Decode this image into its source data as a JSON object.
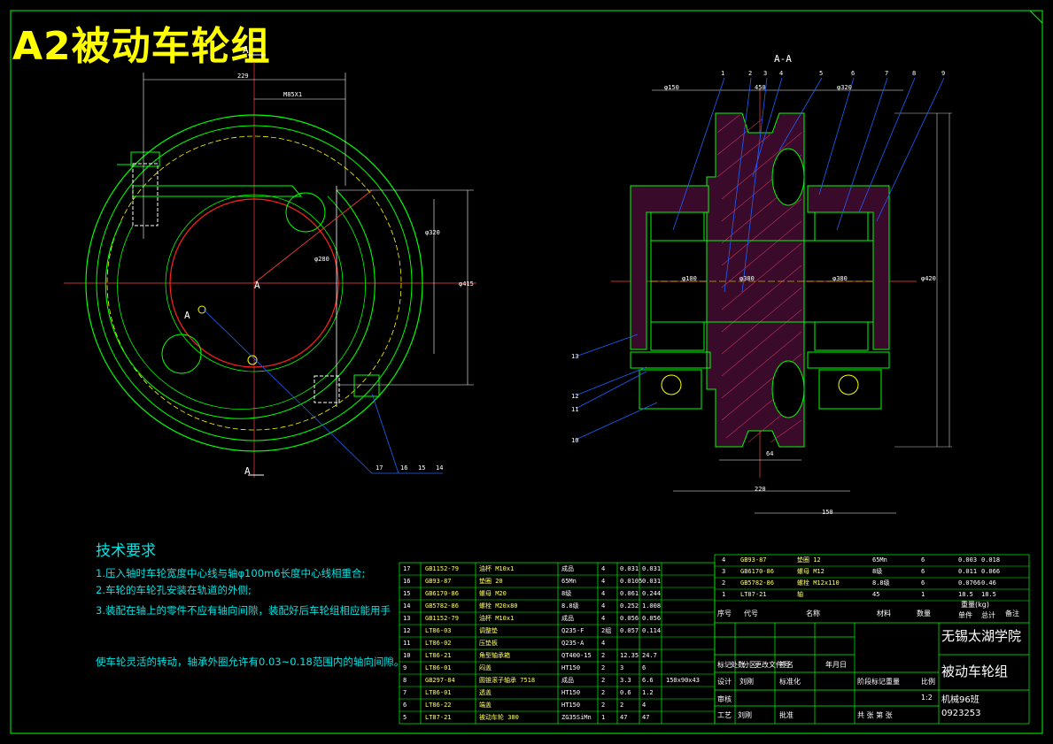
{
  "title": "A2被动车轮组",
  "section_label": "A-A",
  "view_marks": {
    "a_top": "A",
    "a_bottom": "A",
    "a_left": "A",
    "a_center": "A"
  },
  "dimensions_left": {
    "d1": "229",
    "d2": "M85X1",
    "d3": "φ280",
    "d4": "φ320",
    "d5": "φ415"
  },
  "dimensions_right": {
    "d1": "φ150",
    "d2": "450",
    "d3": "φ320",
    "d4": "φ100",
    "d5": "φ380",
    "d6": "φ380",
    "d7": "φ420",
    "d8": "64",
    "d9": "220",
    "d10": "150"
  },
  "balloons_top": [
    "1",
    "2",
    "3",
    "4",
    "5",
    "6",
    "7",
    "8",
    "9"
  ],
  "balloons_left": [
    "13",
    "12",
    "11",
    "10"
  ],
  "balloons_bottom": [
    "17",
    "16",
    "15",
    "14"
  ],
  "tech_requirements": {
    "heading": "技术要求",
    "items": [
      "1.压入轴时车轮宽度中心线与轴φ100m6长度中心线相重合;",
      "2.车轮的车轮孔安装在轨道的外侧;",
      "3.装配在轴上的零件不应有轴向间隙，装配好后车轮组相应能用手",
      "使车轮灵活的转动，轴承外圈允许有0.03~0.18范围内的轴向间隙。"
    ]
  },
  "parts_list_left": [
    {
      "no": "17",
      "code": "GB1152-79",
      "name": "油杯 M10x1",
      "material": "成品",
      "qty": "4",
      "unit": "0.031",
      "total": "0.031"
    },
    {
      "no": "16",
      "code": "GB93-87",
      "name": "垫圈 20",
      "material": "65Mn",
      "qty": "4",
      "unit": "0.0105",
      "total": "0.031"
    },
    {
      "no": "15",
      "code": "GB6170-86",
      "name": "螺母 M20",
      "material": "8级",
      "qty": "4",
      "unit": "0.061",
      "total": "0.244"
    },
    {
      "no": "14",
      "code": "GB5782-86",
      "name": "螺栓 M20x80",
      "material": "8.8级",
      "qty": "4",
      "unit": "0.252",
      "total": "1.008"
    },
    {
      "no": "13",
      "code": "GB1152-79",
      "name": "油杯 M10x1",
      "material": "成品",
      "qty": "4",
      "unit": "0.056",
      "total": "0.056"
    },
    {
      "no": "12",
      "code": "LT86-03",
      "name": "调整垫",
      "material": "Q235-F",
      "qty": "2组",
      "unit": "0.057",
      "total": "0.114"
    },
    {
      "no": "11",
      "code": "LT86-02",
      "name": "压垫板",
      "material": "Q235-A",
      "qty": "4",
      "unit": "",
      "total": ""
    },
    {
      "no": "10",
      "code": "LT86-21",
      "name": "角型轴承箱",
      "material": "QT400-15",
      "qty": "2",
      "unit": "12.35",
      "total": "24.7"
    },
    {
      "no": "9",
      "code": "LT86-01",
      "name": "闷盖",
      "material": "HT150",
      "qty": "2",
      "unit": "3",
      "total": "6"
    },
    {
      "no": "8",
      "code": "GB297-84",
      "name": "圆锥滚子轴承 7518",
      "material": "成品",
      "qty": "2",
      "unit": "3.3",
      "total": "6.6",
      "note": "150x90x43"
    },
    {
      "no": "7",
      "code": "LT86-01",
      "name": "透盖",
      "material": "HT150",
      "qty": "2",
      "unit": "0.6",
      "total": "1.2"
    },
    {
      "no": "6",
      "code": "LT86-22",
      "name": "端盖",
      "material": "HT150",
      "qty": "2",
      "unit": "2",
      "total": "4"
    },
    {
      "no": "5",
      "code": "LT87-21",
      "name": "被动车轮 380",
      "material": "ZG35SiMn",
      "qty": "1",
      "unit": "47",
      "total": "47"
    }
  ],
  "parts_list_right": [
    {
      "no": "4",
      "code": "GB93-87",
      "name": "垫圈 12",
      "material": "65Mn",
      "qty": "6",
      "unit": "0.003",
      "total": "0.018"
    },
    {
      "no": "3",
      "code": "GB6170-86",
      "name": "螺母 M12",
      "material": "8级",
      "qty": "6",
      "unit": "0.011",
      "total": "0.066"
    },
    {
      "no": "2",
      "code": "GB5782-86",
      "name": "螺栓 M12x110",
      "material": "8.8级",
      "qty": "6",
      "unit": "0.0766",
      "total": "0.46"
    },
    {
      "no": "1",
      "code": "LT87-21",
      "name": "轴",
      "material": "45",
      "qty": "1",
      "unit": "18.5",
      "total": "18.5"
    }
  ],
  "parts_header": {
    "no": "序号",
    "code": "代号",
    "name": "名称",
    "material": "材料",
    "qty": "数量",
    "unit": "单件",
    "total": "总计",
    "weight": "重量(kg)",
    "note": "备注"
  },
  "title_block": {
    "school": "无锡太湖学院",
    "drawing_name": "被动车轮组",
    "class": "机械96班",
    "number": "0923253",
    "scale": "1:2",
    "row_labels": [
      "标记",
      "处数",
      "分区",
      "更改文件号",
      "签名",
      "年月日"
    ],
    "designer_row": [
      "设计",
      "刘刚",
      "标准化",
      "阶段标记",
      "重量",
      "比例"
    ],
    "review": "审核",
    "process": "工艺",
    "process_name": "刘刚",
    "approve": "批准",
    "sheets": "共 张   第 张"
  }
}
